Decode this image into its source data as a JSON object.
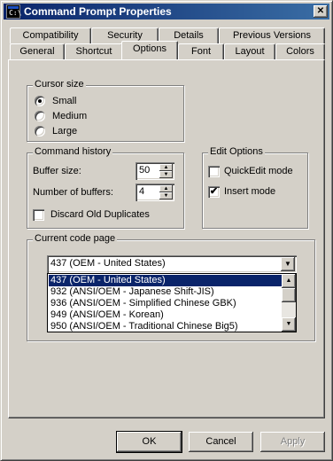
{
  "window": {
    "title": "Command Prompt Properties",
    "icon": "cmd-icon",
    "icon_glyph": "C:\\",
    "close_glyph": "✕"
  },
  "tabs": {
    "back_row": [
      "Compatibility",
      "Security",
      "Details",
      "Previous Versions"
    ],
    "front_row": [
      "General",
      "Shortcut",
      "Options",
      "Font",
      "Layout",
      "Colors"
    ],
    "active": "Options"
  },
  "cursor_size": {
    "legend": "Cursor size",
    "options": [
      "Small",
      "Medium",
      "Large"
    ],
    "selected": "Small"
  },
  "command_history": {
    "legend": "Command history",
    "buffer_size_label": "Buffer size:",
    "buffer_size_value": "50",
    "num_buffers_label": "Number of buffers:",
    "num_buffers_value": "4",
    "discard_label": "Discard Old Duplicates",
    "discard_checked": false
  },
  "edit_options": {
    "legend": "Edit Options",
    "quickedit_label": "QuickEdit mode",
    "quickedit_checked": false,
    "insert_label": "Insert mode",
    "insert_checked": true,
    "check_glyph": "✔"
  },
  "code_page": {
    "legend": "Current code page",
    "selected_value": "437   (OEM - United States)",
    "options": [
      "437   (OEM - United States)",
      "932   (ANSI/OEM - Japanese Shift-JIS)",
      "936   (ANSI/OEM - Simplified Chinese GBK)",
      "949   (ANSI/OEM - Korean)",
      "950   (ANSI/OEM - Traditional Chinese Big5)"
    ],
    "highlighted_index": 0
  },
  "buttons": {
    "ok": "OK",
    "cancel": "Cancel",
    "apply": "Apply"
  },
  "colors": {
    "title_gradient_start": "#0a246a",
    "title_gradient_end": "#3a6ea5",
    "face": "#d4d0c8",
    "selection": "#0a246a"
  }
}
